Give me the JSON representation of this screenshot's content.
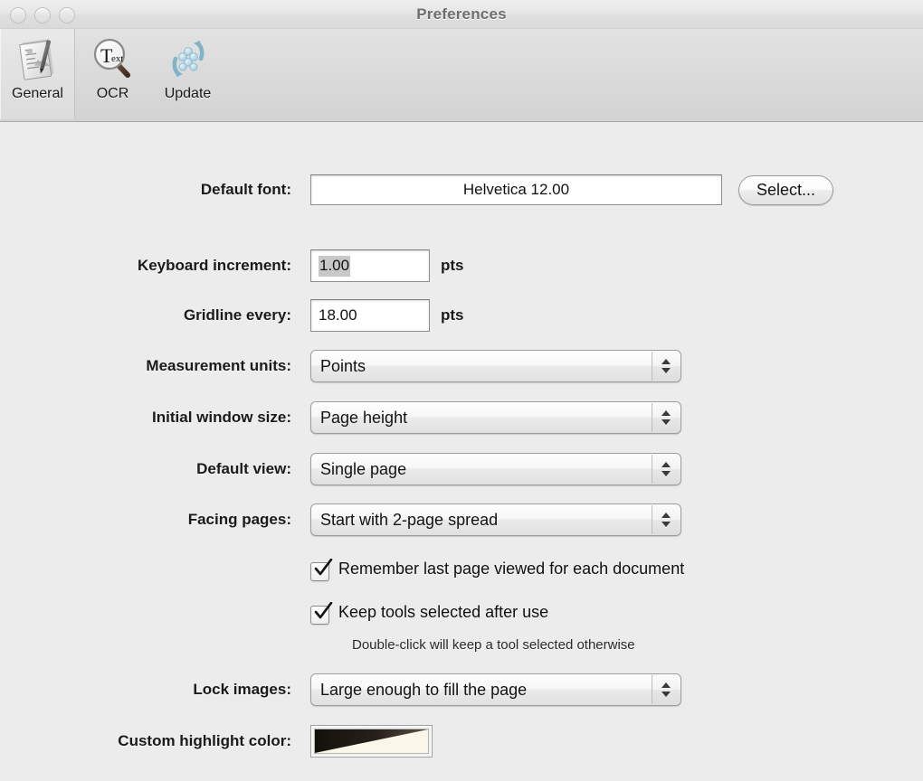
{
  "window": {
    "title": "Preferences",
    "traffic_lights": [
      "close",
      "minimize",
      "zoom"
    ]
  },
  "toolbar": {
    "items": [
      {
        "label": "General",
        "icon": "document-pen-icon",
        "selected": true
      },
      {
        "label": "OCR",
        "icon": "magnifier-text-icon",
        "selected": false
      },
      {
        "label": "Update",
        "icon": "refresh-arrows-icon",
        "selected": false
      }
    ]
  },
  "form": {
    "default_font": {
      "label": "Default font:",
      "value": "Helvetica 12.00",
      "button_label": "Select..."
    },
    "keyboard_increment": {
      "label": "Keyboard increment:",
      "value": "1.00",
      "units": "pts",
      "selected": true
    },
    "gridline_every": {
      "label": "Gridline every:",
      "value": "18.00",
      "units": "pts",
      "selected": false
    },
    "measurement_units": {
      "label": "Measurement units:",
      "value": "Points"
    },
    "initial_window_size": {
      "label": "Initial window size:",
      "value": "Page height"
    },
    "default_view": {
      "label": "Default view:",
      "value": "Single page"
    },
    "facing_pages": {
      "label": "Facing pages:",
      "value": "Start with 2-page spread"
    },
    "remember_last_page": {
      "label": "Remember last page viewed for each document",
      "checked": true
    },
    "keep_tools_selected": {
      "label": "Keep tools selected after use",
      "checked": true,
      "note": "Double-click will keep a tool selected otherwise"
    },
    "lock_images": {
      "label": "Lock images:",
      "value": "Large enough to fill the page"
    },
    "custom_highlight_color": {
      "label": "Custom highlight color:",
      "swatch_dark": "#1b1710",
      "swatch_light": "#faf7e8"
    }
  }
}
